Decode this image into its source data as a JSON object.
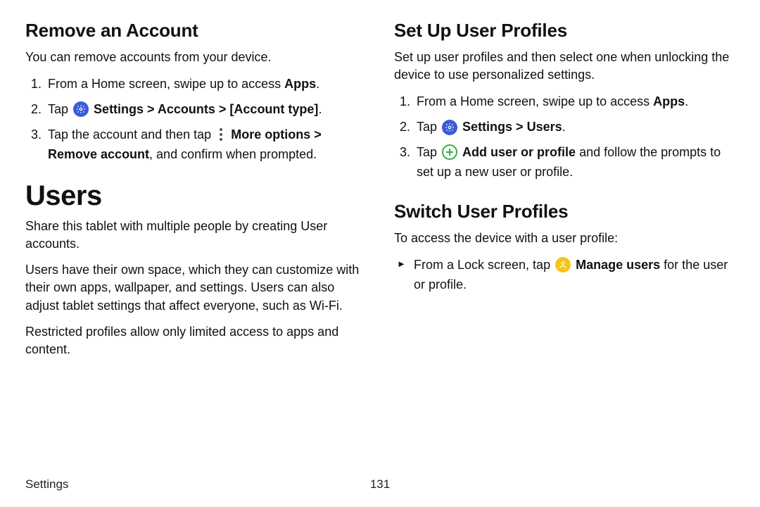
{
  "left": {
    "h_remove": "Remove an Account",
    "p_remove_intro": "You can remove accounts from your device.",
    "li1_a": "From a Home screen, swipe up to access ",
    "li1_b": "Apps",
    "li1_c": ".",
    "li2_a": "Tap ",
    "li2_b": "Settings > Accounts > [Account type]",
    "li2_c": ".",
    "li3_a": "Tap the account and then tap ",
    "li3_b": "More options > Remove account",
    "li3_c": ", and confirm when prompted.",
    "h_users": "Users",
    "p_users_1": "Share this tablet with multiple people by creating User accounts.",
    "p_users_2": "Users have their own space, which they can customize with their own apps, wallpaper, and settings. Users can also adjust tablet settings that affect everyone, such as Wi-Fi.",
    "p_users_3": "Restricted profiles allow only limited access to apps and content."
  },
  "right": {
    "h_setup": "Set Up User Profiles",
    "p_setup_intro": "Set up user profiles and then select one when unlocking the device to use personalized settings.",
    "s1_a": "From a Home screen, swipe up to access ",
    "s1_b": "Apps",
    "s1_c": ".",
    "s2_a": "Tap ",
    "s2_b": "Settings > Users",
    "s2_c": ".",
    "s3_a": "Tap ",
    "s3_b": "Add user or profile",
    "s3_c": " and follow the prompts to set up a new user or profile.",
    "h_switch": "Switch User Profiles",
    "p_switch_intro": "To access the device with a user profile:",
    "sw_a": "From a Lock screen, tap ",
    "sw_b": "Manage users",
    "sw_c": " for the user or profile."
  },
  "footer": {
    "section": "Settings",
    "page": "131"
  }
}
